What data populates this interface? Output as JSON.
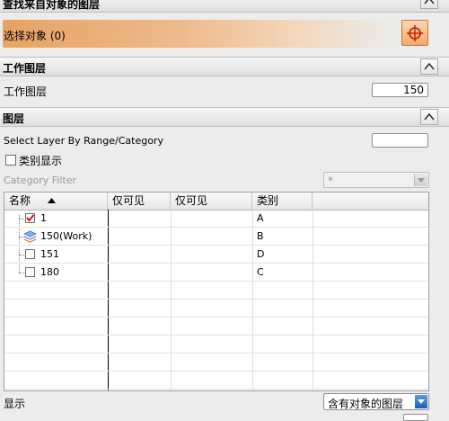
{
  "find_layers_section": {
    "title": "查找来自对象的图层",
    "select_objects_label": "选择对象 (0)"
  },
  "work_layer_section": {
    "title": "工作图层",
    "field_label": "工作图层",
    "field_value": "150"
  },
  "layers_section": {
    "title": "图层",
    "select_by_range_label": "Select Layer By Range/Category",
    "select_by_range_value": "",
    "category_display_label": "类别显示",
    "category_filter_label": "Category Filter",
    "category_filter_value": "*",
    "columns": [
      "名称",
      "仅可见",
      "仅可见",
      "类别"
    ],
    "rows": [
      {
        "name": "1",
        "category": "A",
        "checked": true
      },
      {
        "name": "150(Work)",
        "category": "B",
        "work": true
      },
      {
        "name": "151",
        "category": "D",
        "checked": false
      },
      {
        "name": "180",
        "category": "C",
        "checked": false
      }
    ],
    "display_label": "显示",
    "display_value": "含有对象的图层"
  },
  "colors": {
    "accent_orange": "#e8a362",
    "work_icon_blue": "#3a6fc4",
    "check_red": "#d01010"
  },
  "icons": [
    "chevron-up-icon",
    "crosshair-target-icon",
    "sort-up-icon",
    "checkbox-checked-icon",
    "layer-stack-icon",
    "dropdown-arrow-icon"
  ]
}
